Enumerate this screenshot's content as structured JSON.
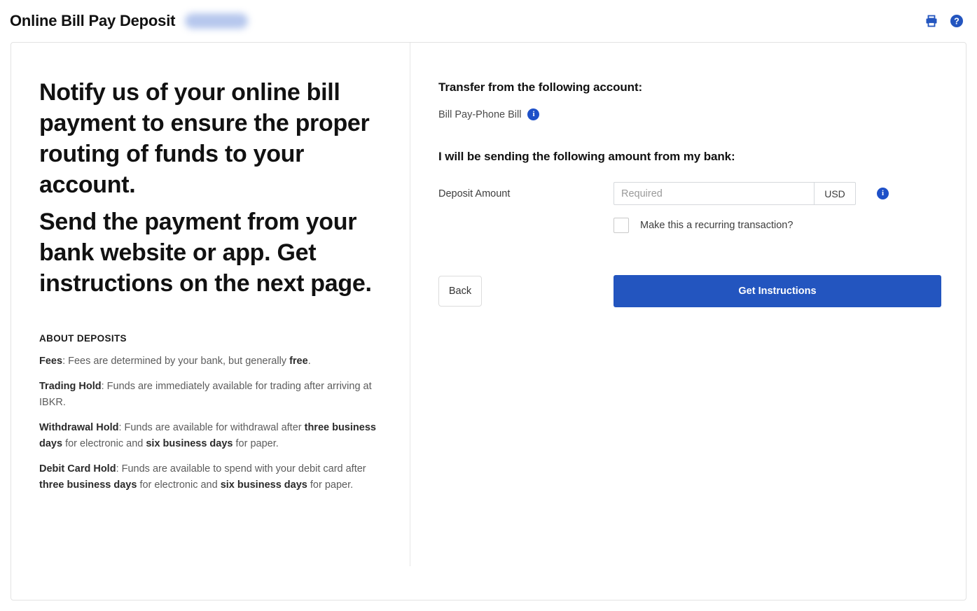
{
  "header": {
    "title": "Online Bill Pay Deposit",
    "account_badge_redacted": "",
    "print_icon": "print-icon",
    "help_icon": "help-circle-icon"
  },
  "left": {
    "lede_1": "Notify us of your online bill payment to ensure the proper routing of funds to your account.",
    "lede_2": "Send the payment from your bank website or app. Get instructions on the next page.",
    "about_title": "ABOUT DEPOSITS",
    "about_items": [
      {
        "term": "Fees",
        "text": ": Fees are determined by your bank, but generally ",
        "emphasis": "free",
        "tail": "."
      },
      {
        "term": "Trading Hold",
        "text": ": Funds are immediately available for trading after arriving at IBKR.",
        "emphasis": "",
        "tail": ""
      },
      {
        "term": "Withdrawal Hold",
        "text": ": Funds are available for withdrawal after ",
        "emphasis": "three business days",
        "tail": " for electronic and ",
        "emphasis2": "six business days",
        "tail2": " for paper."
      },
      {
        "term": "Debit Card Hold",
        "text": ": Funds are available to spend with your debit card after ",
        "emphasis": "three business days",
        "tail": " for electronic and ",
        "emphasis2": "six business days",
        "tail2": " for paper."
      }
    ]
  },
  "right": {
    "transfer_heading": "Transfer from the following account:",
    "account_name": "Bill Pay-Phone Bill",
    "account_info_icon": "info-icon",
    "amount_heading": "I will be sending the following amount from my bank:",
    "deposit_amount_label": "Deposit Amount",
    "deposit_amount_value": "",
    "deposit_amount_placeholder": "Required",
    "currency": "USD",
    "amount_info_icon": "info-icon",
    "recurring_label": "Make this a recurring transaction?",
    "recurring_checked": false,
    "back_label": "Back",
    "submit_label": "Get Instructions"
  },
  "colors": {
    "primary_blue": "#2355bf",
    "icon_blue": "#1e50c8",
    "card_border": "#e2e2e2",
    "muted_text": "#5c5c5c"
  }
}
